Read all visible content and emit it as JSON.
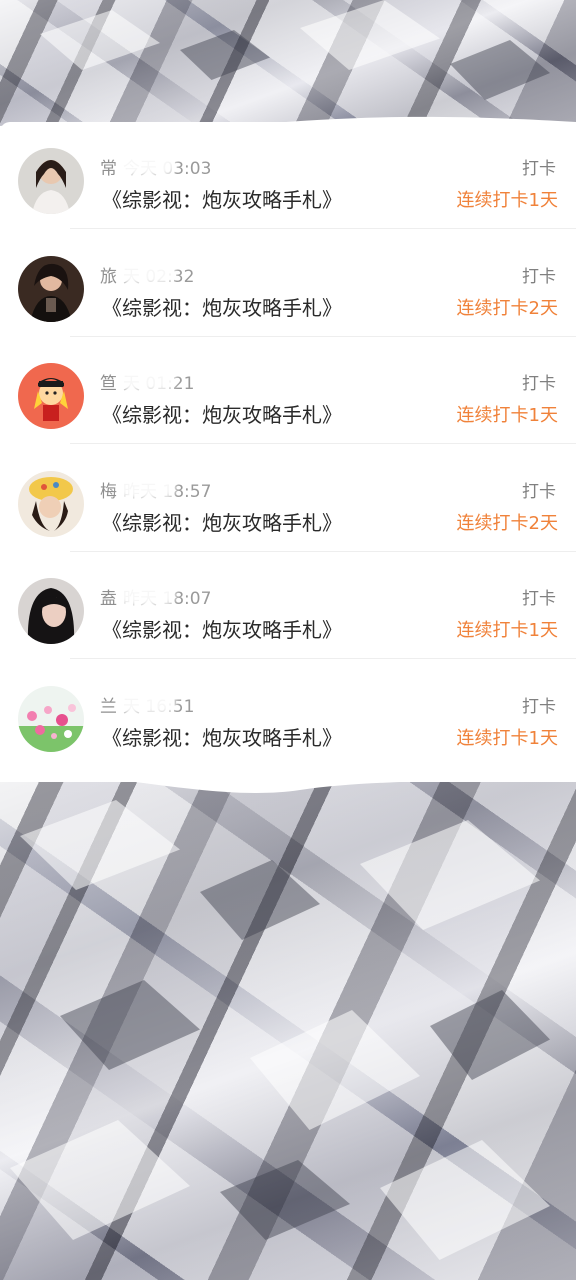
{
  "checkin_list": [
    {
      "name": "常",
      "time": "今天 03:03",
      "book": "《综影视：炮灰攻略手札》",
      "label": "打卡",
      "streak": "连续打卡1天",
      "avatar_icon": "girl-portrait-icon"
    },
    {
      "name": "旅",
      "time": "天 02:32",
      "book": "《综影视：炮灰攻略手札》",
      "label": "打卡",
      "streak": "连续打卡2天",
      "avatar_icon": "dark-portrait-icon"
    },
    {
      "name": "笪",
      "time": "天 01:21",
      "book": "《综影视：炮灰攻略手札》",
      "label": "打卡",
      "streak": "连续打卡1天",
      "avatar_icon": "cartoon-girl-icon"
    },
    {
      "name": "梅",
      "time": "昨天 18:57",
      "book": "《综影视：炮灰攻略手札》",
      "label": "打卡",
      "streak": "连续打卡2天",
      "avatar_icon": "hat-girl-icon"
    },
    {
      "name": "盍",
      "time": "昨天 18:07",
      "book": "《综影视：炮灰攻略手札》",
      "label": "打卡",
      "streak": "连续打卡1天",
      "avatar_icon": "dark-hair-girl-icon"
    },
    {
      "name": "兰",
      "time": "天 16:51",
      "book": "《综影视：炮灰攻略手札》",
      "label": "打卡",
      "streak": "连续打卡1天",
      "avatar_icon": "flower-field-icon"
    }
  ],
  "colors": {
    "accent": "#f0823a",
    "text": "#2a2a2a",
    "muted": "#9a9a9a"
  }
}
